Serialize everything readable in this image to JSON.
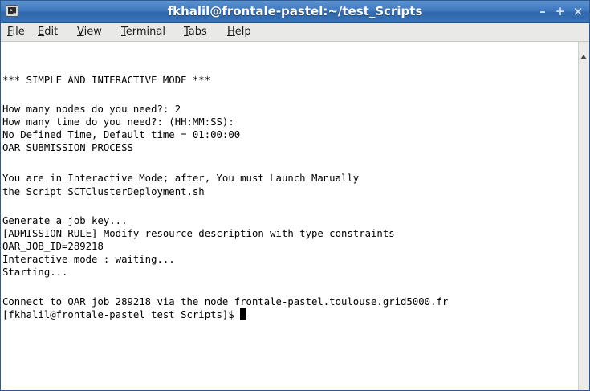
{
  "window": {
    "title": "fkhalil@frontale-pastel:~/test_Scripts",
    "icon": "terminal-icon",
    "icon_prompt": ">_",
    "buttons": {
      "minimize": "–",
      "maximize": "+",
      "close": "×"
    }
  },
  "menu": [
    {
      "mnemonic": "F",
      "rest": "ile"
    },
    {
      "mnemonic": "E",
      "rest": "dit"
    },
    {
      "mnemonic": "V",
      "rest": "iew"
    },
    {
      "mnemonic": "T",
      "rest": "erminal"
    },
    {
      "mnemonic": "T",
      "rest": "abs"
    },
    {
      "mnemonic": "H",
      "rest": "elp"
    }
  ],
  "terminal": {
    "lines": [
      "*** SIMPLE AND INTERACTIVE MODE ***",
      "How many nodes do you need?: 2",
      "How many time do you need?: (HH:MM:SS):",
      "No Defined Time, Default time = 01:00:00",
      "OAR SUBMISSION PROCESS",
      "You are in Interactive Mode; after, You must Launch Manually",
      "the Script SCTClusterDeployment.sh",
      "Generate a job key...",
      "[ADMISSION RULE] Modify resource description with type constraints",
      "OAR_JOB_ID=289218",
      "Interactive mode : waiting...",
      "Starting...",
      "Connect to OAR job 289218 via the node frontale-pastel.toulouse.grid5000.fr"
    ],
    "prompt": "[fkhalil@frontale-pastel test_Scripts]$ "
  },
  "colors": {
    "titlebar": "#3f78bf",
    "text": "#000000",
    "background": "#ffffff"
  }
}
